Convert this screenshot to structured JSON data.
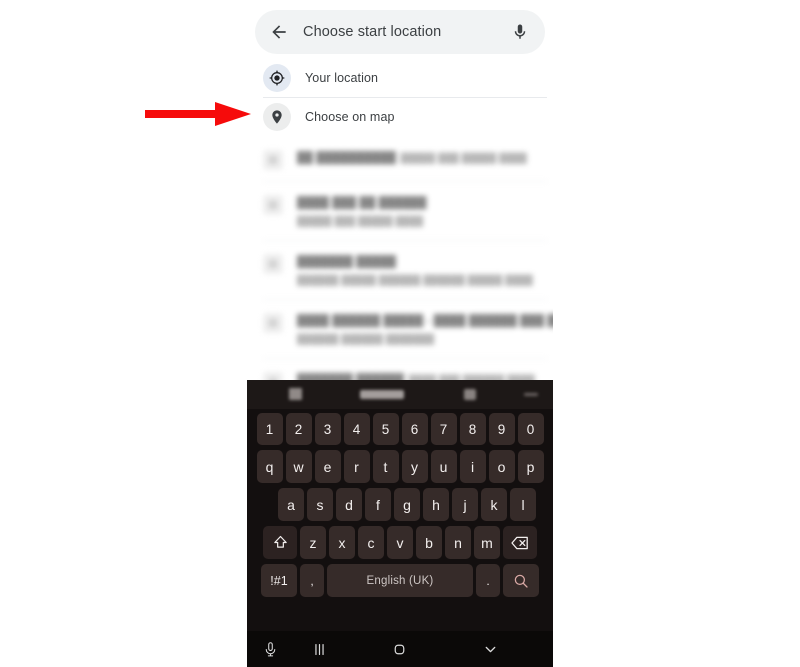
{
  "screen": {
    "app": "maps-location-picker",
    "background_color": "#ffffff"
  },
  "search_bar": {
    "back_icon": "back-arrow-icon",
    "title": "Choose start location",
    "mic_icon": "microphone-icon"
  },
  "options": [
    {
      "icon": "my-location-crosshair-icon",
      "label": "Your location"
    },
    {
      "icon": "map-pin-icon",
      "label": "Choose on map"
    }
  ],
  "suggestions": {
    "note": "blurred-redacted",
    "items": [
      {
        "icon": "place-icon",
        "title": "",
        "subtitle": ""
      },
      {
        "icon": "place-icon",
        "title": "",
        "subtitle": ""
      },
      {
        "icon": "place-icon",
        "title": "",
        "subtitle": ""
      },
      {
        "icon": "place-icon",
        "title": "",
        "subtitle": ""
      },
      {
        "icon": "place-icon",
        "title": "",
        "subtitle": ""
      }
    ]
  },
  "annotation": {
    "type": "arrow",
    "color": "#f60b0b",
    "points_to": "Choose on map"
  },
  "keyboard": {
    "theme_color": "#130f0f",
    "key_color": "#362b29",
    "toolbar": [
      {
        "icon": "sticker-icon"
      },
      {
        "icon": "clipboard-suggestion-chip"
      },
      {
        "icon": "settings-icon"
      },
      {
        "icon": "more-handle-icon"
      }
    ],
    "rows": {
      "numbers": [
        "1",
        "2",
        "3",
        "4",
        "5",
        "6",
        "7",
        "8",
        "9",
        "0"
      ],
      "top": [
        "q",
        "w",
        "e",
        "r",
        "t",
        "y",
        "u",
        "i",
        "o",
        "p"
      ],
      "home": [
        "a",
        "s",
        "d",
        "f",
        "g",
        "h",
        "j",
        "k",
        "l"
      ],
      "bottom": [
        "z",
        "x",
        "c",
        "v",
        "b",
        "n",
        "m"
      ]
    },
    "shift_key": {
      "icon": "shift-arrow-icon"
    },
    "backspace_key": {
      "icon": "backspace-icon"
    },
    "symbols_key": {
      "label": "!#1"
    },
    "comma_key": {
      "label": ","
    },
    "space_key": {
      "label": "English (UK)"
    },
    "period_key": {
      "label": "."
    },
    "enter_key": {
      "icon": "search-magnifier-icon",
      "color": "#d9a9a5"
    }
  },
  "nav_bar": [
    {
      "icon": "microphone-icon"
    },
    {
      "icon": "recents-icon"
    },
    {
      "icon": "home-icon"
    },
    {
      "icon": "hide-keyboard-chevron-icon"
    }
  ]
}
